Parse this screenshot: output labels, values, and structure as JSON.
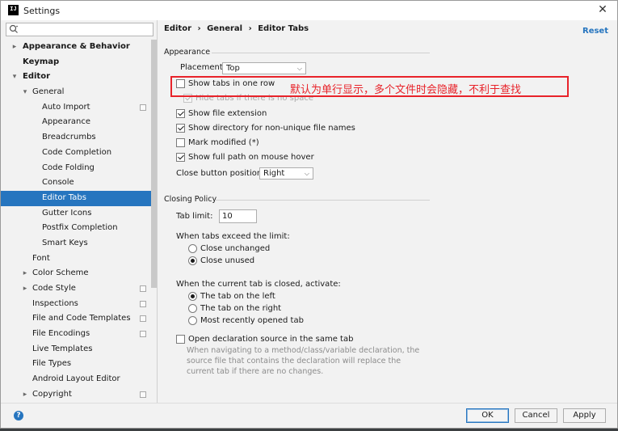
{
  "window": {
    "title": "Settings",
    "app_icon_text": "IJ"
  },
  "sidebar": {
    "search": {
      "placeholder": "",
      "value": ""
    },
    "items": [
      {
        "label": "Appearance & Behavior",
        "arrow": "▸",
        "bold": true,
        "project": false
      },
      {
        "label": "Keymap",
        "arrow": "",
        "bold": true,
        "project": false
      },
      {
        "label": "Editor",
        "arrow": "▾",
        "bold": true,
        "project": false
      },
      {
        "label": "General",
        "arrow": "▾",
        "bold": false,
        "project": false
      },
      {
        "label": "Auto Import",
        "arrow": "",
        "bold": false,
        "project": true
      },
      {
        "label": "Appearance",
        "arrow": "",
        "bold": false,
        "project": false
      },
      {
        "label": "Breadcrumbs",
        "arrow": "",
        "bold": false,
        "project": false
      },
      {
        "label": "Code Completion",
        "arrow": "",
        "bold": false,
        "project": false
      },
      {
        "label": "Code Folding",
        "arrow": "",
        "bold": false,
        "project": false
      },
      {
        "label": "Console",
        "arrow": "",
        "bold": false,
        "project": false
      },
      {
        "label": "Editor Tabs",
        "arrow": "",
        "bold": false,
        "project": false,
        "selected": true
      },
      {
        "label": "Gutter Icons",
        "arrow": "",
        "bold": false,
        "project": false
      },
      {
        "label": "Postfix Completion",
        "arrow": "",
        "bold": false,
        "project": false
      },
      {
        "label": "Smart Keys",
        "arrow": "",
        "bold": false,
        "project": false
      },
      {
        "label": "Font",
        "arrow": "",
        "bold": false,
        "project": false
      },
      {
        "label": "Color Scheme",
        "arrow": "▸",
        "bold": false,
        "project": false
      },
      {
        "label": "Code Style",
        "arrow": "▸",
        "bold": false,
        "project": true
      },
      {
        "label": "Inspections",
        "arrow": "",
        "bold": false,
        "project": true
      },
      {
        "label": "File and Code Templates",
        "arrow": "",
        "bold": false,
        "project": true
      },
      {
        "label": "File Encodings",
        "arrow": "",
        "bold": false,
        "project": true
      },
      {
        "label": "Live Templates",
        "arrow": "",
        "bold": false,
        "project": false
      },
      {
        "label": "File Types",
        "arrow": "",
        "bold": false,
        "project": false
      },
      {
        "label": "Android Layout Editor",
        "arrow": "",
        "bold": false,
        "project": false
      },
      {
        "label": "Copyright",
        "arrow": "▸",
        "bold": false,
        "project": true
      }
    ]
  },
  "breadcrumb": [
    "Editor",
    "›",
    "General",
    "›",
    "Editor Tabs"
  ],
  "reset_label": "Reset",
  "appearance": {
    "title": "Appearance",
    "placement_label": "Placement:",
    "placement_value": "Top",
    "show_tabs_one_row": {
      "label": "Show tabs in one row",
      "checked": false
    },
    "hide_tabs_no_space": {
      "label": "Hide tabs if there is no space",
      "checked": true,
      "disabled": true
    },
    "show_file_extension": {
      "label": "Show file extension",
      "checked": true
    },
    "show_directory": {
      "label": "Show directory for non-unique file names",
      "checked": true
    },
    "mark_modified": {
      "label": "Mark modified (*)",
      "checked": false
    },
    "show_full_path": {
      "label": "Show full path on mouse hover",
      "checked": true
    },
    "close_button_label": "Close button position:",
    "close_button_value": "Right"
  },
  "annotation": {
    "text": "默认为单行显示，多个文件时会隐藏，不利于查找",
    "color": "#e8232a"
  },
  "closing_policy": {
    "title": "Closing Policy",
    "tab_limit_label": "Tab limit:",
    "tab_limit_value": "10",
    "exceed_label": "When tabs exceed the limit:",
    "close_unchanged": "Close unchanged",
    "close_unused": "Close unused",
    "activate_label": "When the current tab is closed, activate:",
    "tab_left": "The tab on the left",
    "tab_right": "The tab on the right",
    "recently_opened": "Most recently opened tab",
    "open_declaration": {
      "label": "Open declaration source in the same tab",
      "checked": false
    },
    "open_declaration_desc": "When navigating to a method/class/variable declaration, the source file that contains the declaration will replace the current tab if there are no changes."
  },
  "buttons": {
    "ok": "OK",
    "cancel": "Cancel",
    "apply": "Apply"
  },
  "colors": {
    "accent": "#2675bf",
    "annotation": "#e8232a"
  }
}
